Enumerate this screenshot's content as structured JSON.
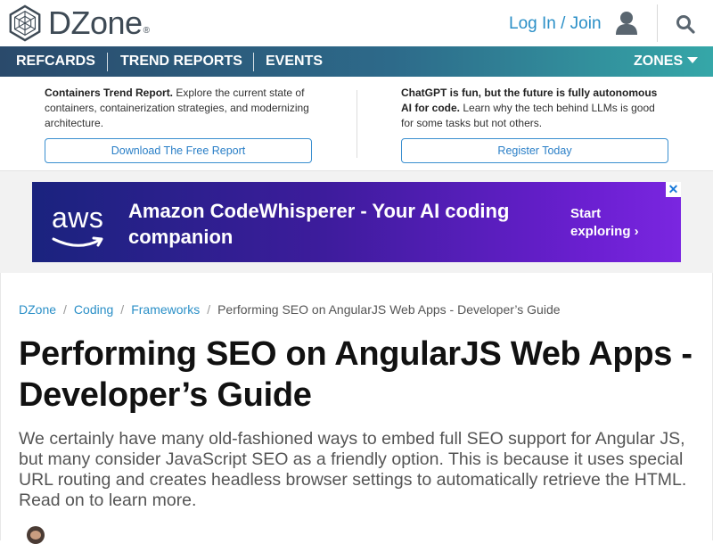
{
  "header": {
    "logo_text": "DZone",
    "logo_reg": "®",
    "login_label": "Log In / Join"
  },
  "nav": {
    "items": [
      "REFCARDS",
      "TREND REPORTS",
      "EVENTS"
    ],
    "zones_label": "ZONES"
  },
  "promo": {
    "left": {
      "title": "Containers Trend Report.",
      "body": " Explore the current state of containers, containerization strategies, and modernizing architecture.",
      "button": "Download The Free Report"
    },
    "right": {
      "title": "ChatGPT is fun, but the future is fully autonomous AI for code.",
      "body": " Learn why the tech behind LLMs is good for some tasks but not others.",
      "button": "Register Today"
    }
  },
  "ad": {
    "brand": "aws",
    "headline": "Amazon CodeWhisperer - Your AI coding companion",
    "cta": "Start exploring ›",
    "close": "✕"
  },
  "breadcrumb": {
    "items": [
      "DZone",
      "Coding",
      "Frameworks"
    ],
    "current": "Performing SEO on AngularJS Web Apps - Developer’s Guide",
    "separator": "/"
  },
  "article": {
    "title": "Performing SEO on AngularJS Web Apps - Developer’s Guide",
    "subtitle": "We certainly have many old-fashioned ways to embed full SEO support for Angular JS, but many consider JavaScript SEO as a friendly option. This is because it uses special URL routing and creates headless browser settings to automatically retrieve the HTML. Read on to learn more."
  },
  "colors": {
    "brand_link": "#2a8fc7",
    "nav_start": "#2a4a6b",
    "nav_end": "#35a7a8",
    "ad_start": "#1a237e",
    "ad_end": "#7a26e0"
  },
  "icons": [
    "dzone-logo-icon",
    "user-icon",
    "search-icon",
    "caret-down-icon",
    "aws-smile-icon",
    "close-icon"
  ]
}
